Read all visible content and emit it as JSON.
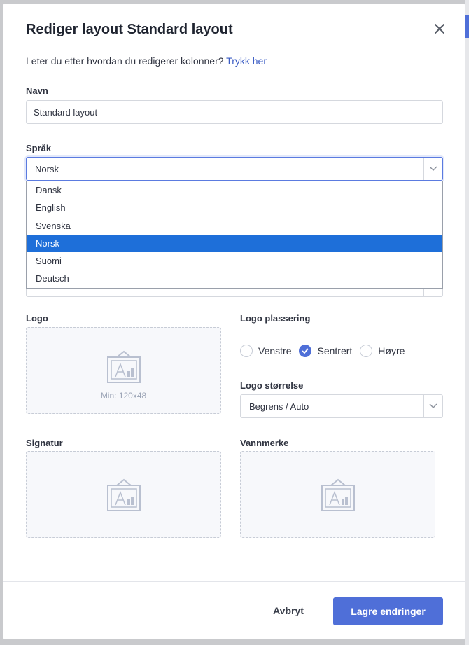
{
  "dialog": {
    "title": "Rediger layout Standard layout",
    "help_text": "Leter du etter hvordan du redigerer kolonner?",
    "help_link": "Trykk her"
  },
  "name_field": {
    "label": "Navn",
    "value": "Standard layout"
  },
  "language": {
    "label": "Språk",
    "selected": "Norsk",
    "options": [
      "Dansk",
      "English",
      "Svenska",
      "Norsk",
      "Suomi",
      "Deutsch"
    ]
  },
  "logo": {
    "label": "Logo",
    "min_size": "Min: 120x48"
  },
  "logo_position": {
    "label": "Logo plassering",
    "options": [
      "Venstre",
      "Sentrert",
      "Høyre"
    ],
    "selected": "Sentrert"
  },
  "logo_size": {
    "label": "Logo størrelse",
    "value": "Begrens / Auto"
  },
  "signature": {
    "label": "Signatur"
  },
  "watermark": {
    "label": "Vannmerke"
  },
  "footer": {
    "cancel_label": "Avbryt",
    "save_label": "Lagre endringer"
  },
  "colors": {
    "accent": "#4f6fd8",
    "selected_option": "#1e6fd9"
  }
}
